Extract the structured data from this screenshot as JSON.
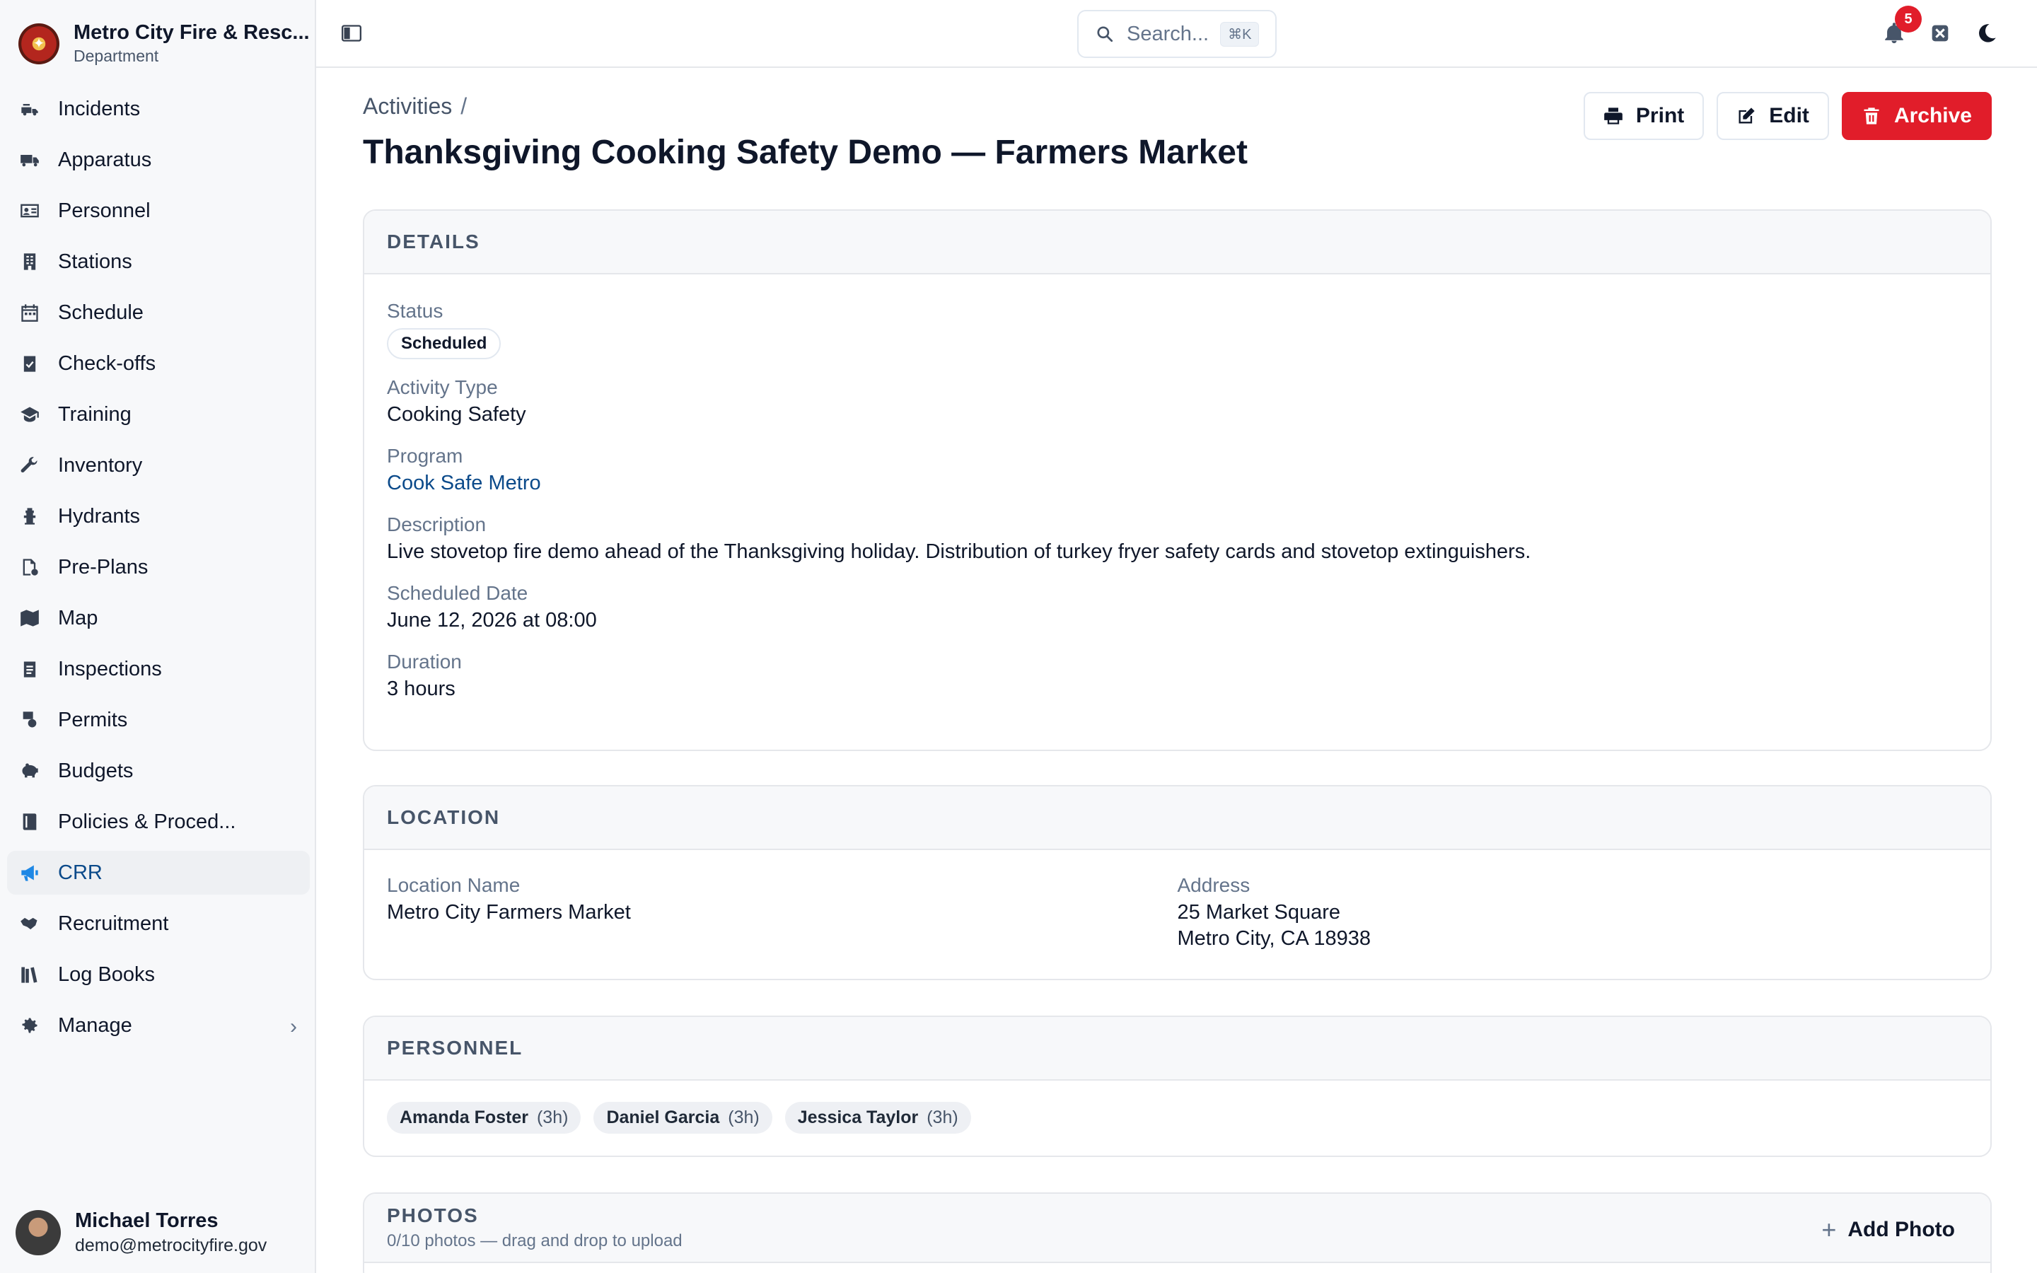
{
  "brand": {
    "name": "Metro City Fire & Resc...",
    "subtitle": "Department"
  },
  "nav": [
    {
      "label": "Incidents",
      "icon": "fire-truck-icon"
    },
    {
      "label": "Apparatus",
      "icon": "truck-icon"
    },
    {
      "label": "Personnel",
      "icon": "id-card-icon"
    },
    {
      "label": "Stations",
      "icon": "building-icon"
    },
    {
      "label": "Schedule",
      "icon": "calendar-icon"
    },
    {
      "label": "Check-offs",
      "icon": "clipboard-check-icon"
    },
    {
      "label": "Training",
      "icon": "graduation-cap-icon"
    },
    {
      "label": "Inventory",
      "icon": "wrench-icon"
    },
    {
      "label": "Hydrants",
      "icon": "hydrant-icon"
    },
    {
      "label": "Pre-Plans",
      "icon": "file-plan-icon"
    },
    {
      "label": "Map",
      "icon": "map-icon"
    },
    {
      "label": "Inspections",
      "icon": "clipboard-list-icon"
    },
    {
      "label": "Permits",
      "icon": "permit-icon"
    },
    {
      "label": "Budgets",
      "icon": "piggy-bank-icon"
    },
    {
      "label": "Policies & Proced...",
      "icon": "book-icon"
    },
    {
      "label": "CRR",
      "icon": "megaphone-icon",
      "active": true
    },
    {
      "label": "Recruitment",
      "icon": "handshake-icon"
    },
    {
      "label": "Log Books",
      "icon": "books-icon"
    }
  ],
  "manage": {
    "label": "Manage",
    "icon": "gear-icon"
  },
  "user": {
    "name": "Michael Torres",
    "email": "demo@metrocityfire.gov"
  },
  "topbar": {
    "search_placeholder": "Search...",
    "search_shortcut": "⌘K",
    "notification_count": "5"
  },
  "breadcrumb": {
    "parent": "Activities",
    "separator": "/"
  },
  "page_title": "Thanksgiving Cooking Safety Demo — Farmers Market",
  "actions": {
    "print": "Print",
    "edit": "Edit",
    "archive": "Archive"
  },
  "details": {
    "heading": "DETAILS",
    "status_label": "Status",
    "status_value": "Scheduled",
    "type_label": "Activity Type",
    "type_value": "Cooking Safety",
    "program_label": "Program",
    "program_value": "Cook Safe Metro",
    "description_label": "Description",
    "description_value": "Live stovetop fire demo ahead of the Thanksgiving holiday. Distribution of turkey fryer safety cards and stovetop extinguishers.",
    "date_label": "Scheduled Date",
    "date_value": "June 12, 2026 at 08:00",
    "duration_label": "Duration",
    "duration_value": "3 hours"
  },
  "location": {
    "heading": "LOCATION",
    "name_label": "Location Name",
    "name_value": "Metro City Farmers Market",
    "address_label": "Address",
    "address_line1": "25 Market Square",
    "address_line2": "Metro City, CA 18938"
  },
  "personnel": {
    "heading": "PERSONNEL",
    "people": [
      {
        "name": "Amanda Foster",
        "hours": "(3h)"
      },
      {
        "name": "Daniel Garcia",
        "hours": "(3h)"
      },
      {
        "name": "Jessica Taylor",
        "hours": "(3h)"
      }
    ]
  },
  "photos": {
    "heading": "PHOTOS",
    "subtitle": "0/10 photos — drag and drop to upload",
    "add_label": "Add Photo"
  },
  "colors": {
    "accent": "#0b4a8a",
    "danger": "#e11d2a",
    "active_icon": "#1e88e5"
  }
}
